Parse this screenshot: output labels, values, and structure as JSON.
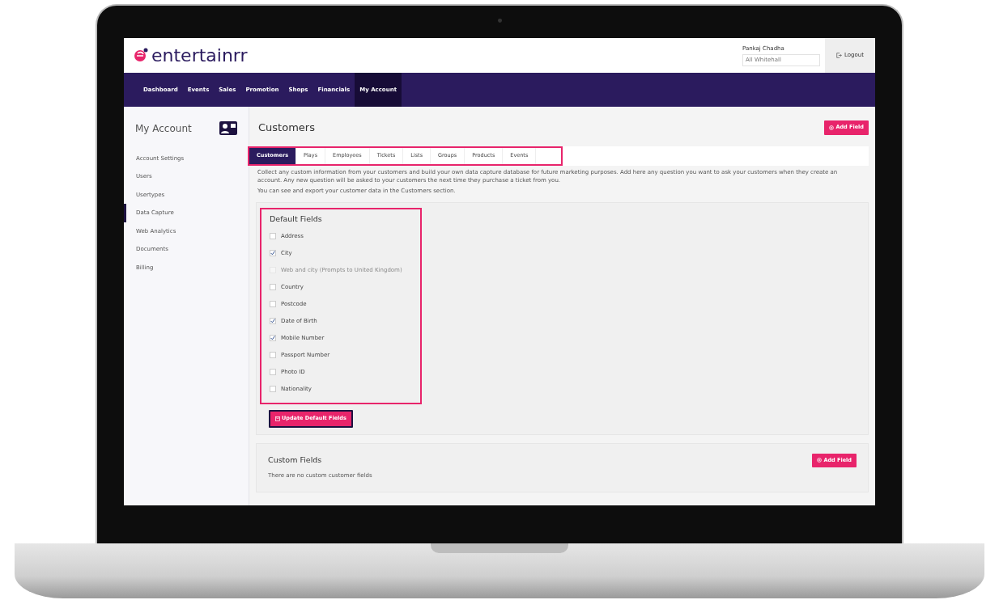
{
  "header": {
    "logo": "entertainrr",
    "user_name": "Pankaj Chadha",
    "account_select": "All Whitehall",
    "logout": "Logout"
  },
  "nav": [
    {
      "label": "Dashboard",
      "selected": false
    },
    {
      "label": "Events",
      "selected": false
    },
    {
      "label": "Sales",
      "selected": false
    },
    {
      "label": "Promotion",
      "selected": false
    },
    {
      "label": "Shops",
      "selected": false
    },
    {
      "label": "Financials",
      "selected": false
    },
    {
      "label": "My Account",
      "selected": true
    }
  ],
  "sidebar": {
    "title": "My Account",
    "items": [
      {
        "label": "Account Settings",
        "selected": false
      },
      {
        "label": "Users",
        "selected": false
      },
      {
        "label": "Usertypes",
        "selected": false
      },
      {
        "label": "Data Capture",
        "selected": true
      },
      {
        "label": "Web Analytics",
        "selected": false
      },
      {
        "label": "Documents",
        "selected": false
      },
      {
        "label": "Billing",
        "selected": false
      }
    ]
  },
  "page": {
    "title": "Customers",
    "add_button": "Add Field"
  },
  "tabs": {
    "highlighted": true,
    "items": [
      {
        "label": "Customers",
        "selected": true
      },
      {
        "label": "Plays",
        "selected": false
      },
      {
        "label": "Employees",
        "selected": false
      },
      {
        "label": "Tickets",
        "selected": false
      },
      {
        "label": "Lists",
        "selected": false
      },
      {
        "label": "Groups",
        "selected": false
      },
      {
        "label": "Products",
        "selected": false
      },
      {
        "label": "Events",
        "selected": false
      }
    ]
  },
  "description": [
    "Collect any custom information from your customers and build your own data capture database for future marketing purposes. Add here any question you want to ask your customers when they create an account. Any new question will be asked to your customers the next time they purchase a ticket from you.",
    "You can see and export your customer data in the Customers section."
  ],
  "default_fields": {
    "title": "Default Fields",
    "highlighted": true,
    "fields": [
      {
        "label": "Address",
        "checked": false,
        "disabled": false
      },
      {
        "label": "City",
        "checked": true,
        "disabled": false
      },
      {
        "label": "Web and city (Prompts to United Kingdom)",
        "checked": false,
        "disabled": true
      },
      {
        "label": "Country",
        "checked": false,
        "disabled": false
      },
      {
        "label": "Postcode",
        "checked": false,
        "disabled": false
      },
      {
        "label": "Date of Birth",
        "checked": true,
        "disabled": false
      },
      {
        "label": "Mobile Number",
        "checked": true,
        "disabled": false
      },
      {
        "label": "Passport Number",
        "checked": false,
        "disabled": false
      },
      {
        "label": "Photo ID",
        "checked": false,
        "disabled": false
      },
      {
        "label": "Nationality",
        "checked": false,
        "disabled": false
      }
    ],
    "update_button": "Update Default Fields"
  },
  "custom_fields": {
    "title": "Custom Fields",
    "add_button": "Add Field",
    "empty_text": "There are no custom customer fields"
  }
}
